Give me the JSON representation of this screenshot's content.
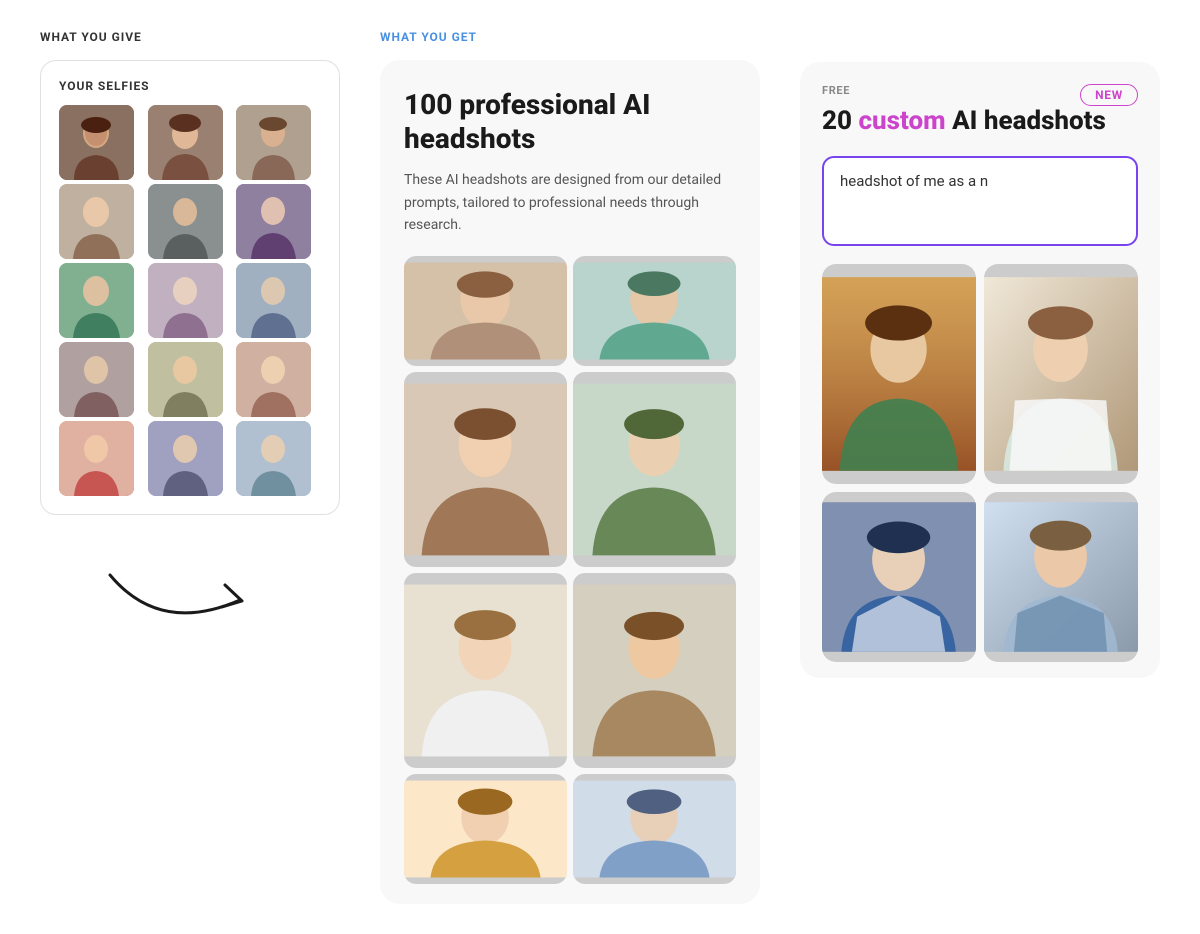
{
  "left": {
    "section_label": "WHAT YOU GIVE",
    "selfies_title": "YOUR SELFIES",
    "photos": [
      {
        "id": "p1",
        "class": "photo-1"
      },
      {
        "id": "p2",
        "class": "photo-2"
      },
      {
        "id": "p3",
        "class": "photo-3"
      },
      {
        "id": "p4",
        "class": "photo-4"
      },
      {
        "id": "p5",
        "class": "photo-5"
      },
      {
        "id": "p6",
        "class": "photo-6"
      },
      {
        "id": "p7",
        "class": "photo-7"
      },
      {
        "id": "p8",
        "class": "photo-8"
      },
      {
        "id": "p9",
        "class": "photo-9"
      },
      {
        "id": "p10",
        "class": "photo-10"
      },
      {
        "id": "p11",
        "class": "photo-11"
      },
      {
        "id": "p12",
        "class": "photo-12"
      },
      {
        "id": "p13",
        "class": "photo-13"
      },
      {
        "id": "p14",
        "class": "photo-14"
      },
      {
        "id": "p15",
        "class": "photo-15"
      }
    ]
  },
  "middle": {
    "section_label": "WHAT YOU GET",
    "card_title": "100 professional AI headshots",
    "card_description": "These AI headshots are designed from our detailed prompts, tailored to professional needs through research.",
    "headshots": [
      {
        "id": "h1",
        "class": "hs-1",
        "size": "short"
      },
      {
        "id": "h2",
        "class": "hs-2",
        "size": "short"
      },
      {
        "id": "h3",
        "class": "hs-3",
        "size": "tall"
      },
      {
        "id": "h4",
        "class": "hs-4",
        "size": "tall"
      },
      {
        "id": "h5",
        "class": "hs-5",
        "size": "tall"
      },
      {
        "id": "h6",
        "class": "hs-6",
        "size": "tall"
      },
      {
        "id": "h7",
        "class": "hs-7",
        "size": "short"
      },
      {
        "id": "h8",
        "class": "hs-8",
        "size": "short"
      }
    ]
  },
  "right": {
    "free_label": "FREE",
    "new_badge": "NEW",
    "title_start": "20 ",
    "title_custom": "custom",
    "title_end": " AI headshots",
    "prompt_value": "headshot of me as a n",
    "prompt_placeholder": "headshot of me as a n",
    "photos": [
      {
        "id": "c1",
        "class": "cp-1",
        "size": "tall"
      },
      {
        "id": "c2",
        "class": "cp-2",
        "size": "tall"
      },
      {
        "id": "c3",
        "class": "cp-3",
        "size": "medium"
      },
      {
        "id": "c4",
        "class": "cp-4",
        "size": "medium"
      }
    ]
  }
}
